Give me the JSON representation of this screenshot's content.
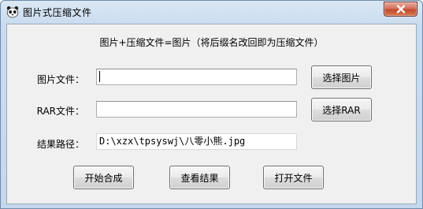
{
  "window": {
    "title": "图片式压缩文件"
  },
  "main": {
    "headline": "图片+压缩文件=图片（将后缀名改回即为压缩文件）",
    "image_file": {
      "label": "图片文件：",
      "value": "",
      "button": "选择图片"
    },
    "rar_file": {
      "label": "RAR文件：",
      "value": "",
      "button": "选择RAR"
    },
    "result_path": {
      "label": "结果路径：",
      "value": "D:\\xzx\\tpsyswj\\八零小熊.jpg"
    },
    "actions": {
      "start": "开始合成",
      "view": "查看结果",
      "open": "打开文件"
    }
  }
}
